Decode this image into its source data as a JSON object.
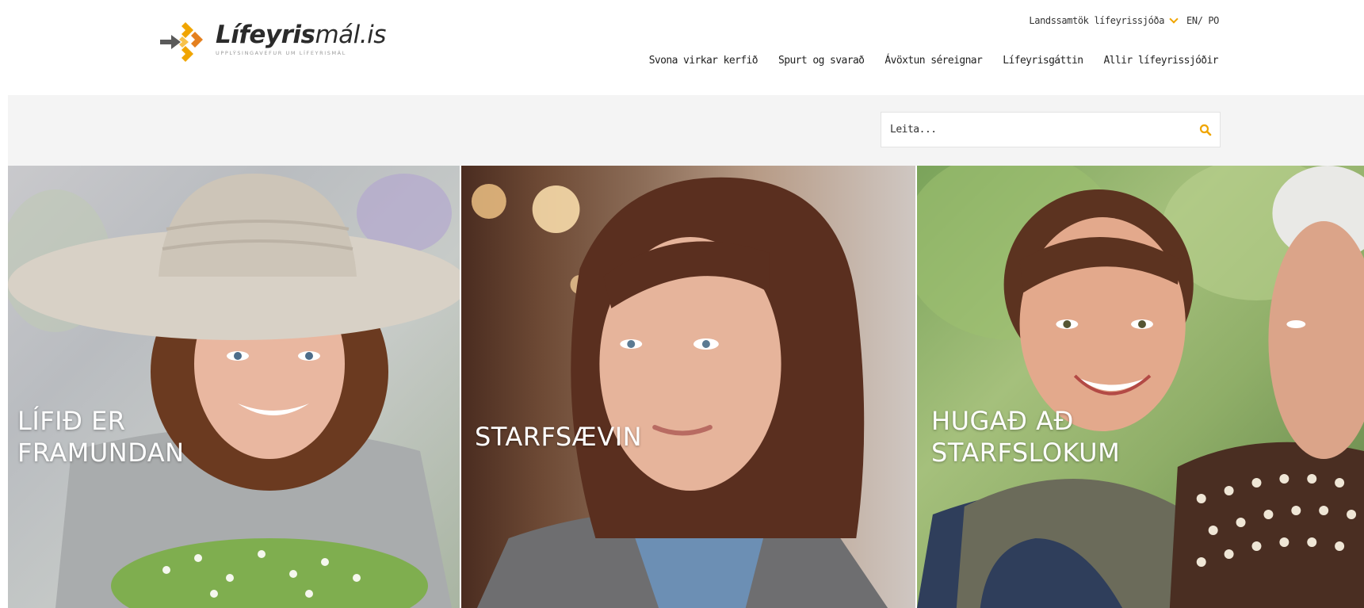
{
  "header": {
    "logo": {
      "word_bold": "Lífeyris",
      "word_light": "mál.is",
      "tagline": "UPPLÝSINGAVEFUR UM LÍFEYRISMÁL",
      "mark_colors": [
        "#f0a500",
        "#e4801f",
        "#5a5a5a"
      ]
    },
    "utility": {
      "org_link": "Landssamtök lífeyrissjóða",
      "org_icon": "chevron-down-icon",
      "lang_link": "EN/ PO"
    },
    "nav": [
      {
        "label": "Svona virkar kerfið"
      },
      {
        "label": "Spurt og svarað"
      },
      {
        "label": "Ávöxtun séreignar"
      },
      {
        "label": "Lífeyrisgáttin"
      },
      {
        "label": "Allir lífeyrissjóðir"
      }
    ]
  },
  "search": {
    "placeholder": "Leita...",
    "icon": "search-icon",
    "accent": "#f0a500"
  },
  "panels": [
    {
      "title": "LÍFIÐ ER\nFRAMUNDAN"
    },
    {
      "title": "STARFSÆVIN"
    },
    {
      "title": "HUGAÐ AÐ\nSTARFSLOKUM"
    }
  ],
  "colors": {
    "accent": "#f0a500",
    "search_band": "#f4f4f4",
    "text": "#222222"
  }
}
